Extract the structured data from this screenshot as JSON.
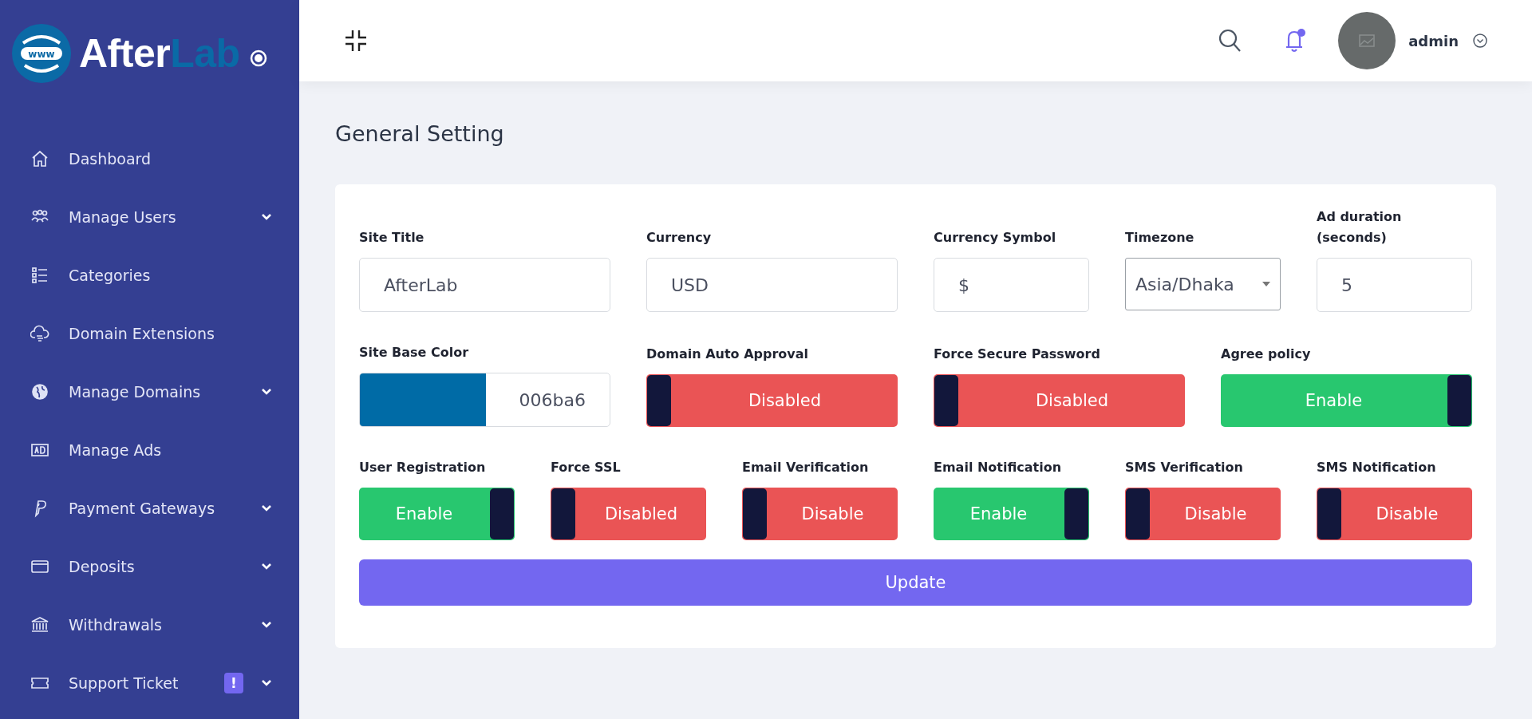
{
  "logo": {
    "globe_text": "www",
    "title_parts": [
      "After",
      "Lab"
    ]
  },
  "sidebar": {
    "items": [
      {
        "label": "Dashboard",
        "expandable": false
      },
      {
        "label": "Manage Users",
        "expandable": true
      },
      {
        "label": "Categories",
        "expandable": false
      },
      {
        "label": "Domain Extensions",
        "expandable": false
      },
      {
        "label": "Manage Domains",
        "expandable": true
      },
      {
        "label": "Manage Ads",
        "expandable": false
      },
      {
        "label": "Payment Gateways",
        "expandable": true
      },
      {
        "label": "Deposits",
        "expandable": true
      },
      {
        "label": "Withdrawals",
        "expandable": true
      },
      {
        "label": "Support Ticket",
        "expandable": true,
        "badge": "!"
      }
    ]
  },
  "header": {
    "user": "admin",
    "notification_dot": true
  },
  "page_title": "General Setting",
  "form": {
    "fields": [
      {
        "kind": "text",
        "label": "Site Title",
        "value": "AfterLab"
      },
      {
        "kind": "text",
        "label": "Currency",
        "value": "USD"
      },
      {
        "kind": "text",
        "label": "Currency Symbol",
        "value": "$"
      },
      {
        "kind": "select",
        "label": "Timezone",
        "value": "Asia/Dhaka"
      },
      {
        "kind": "text",
        "label": "Ad duration (seconds)",
        "value": "5"
      },
      {
        "kind": "color",
        "label": "Site Base Color",
        "value": "006ba6",
        "color": "#006ba6"
      },
      {
        "kind": "toggle",
        "label": "Domain Auto Approval",
        "on": false,
        "text": "Disabled"
      },
      {
        "kind": "toggle",
        "label": "Force Secure Password",
        "on": false,
        "text": "Disabled"
      },
      {
        "kind": "toggle",
        "label": "Agree policy",
        "on": true,
        "text": "Enable"
      },
      {
        "kind": "toggle",
        "label": "User Registration",
        "on": true,
        "text": "Enable"
      },
      {
        "kind": "toggle",
        "label": "Force SSL",
        "on": false,
        "text": "Disabled"
      },
      {
        "kind": "toggle",
        "label": "Email Verification",
        "on": false,
        "text": "Disable"
      },
      {
        "kind": "toggle",
        "label": "Email Notification",
        "on": true,
        "text": "Enable"
      },
      {
        "kind": "toggle",
        "label": "SMS Verification",
        "on": false,
        "text": "Disable"
      },
      {
        "kind": "toggle",
        "label": "SMS Notification",
        "on": false,
        "text": "Disable"
      }
    ],
    "submit": "Update"
  }
}
